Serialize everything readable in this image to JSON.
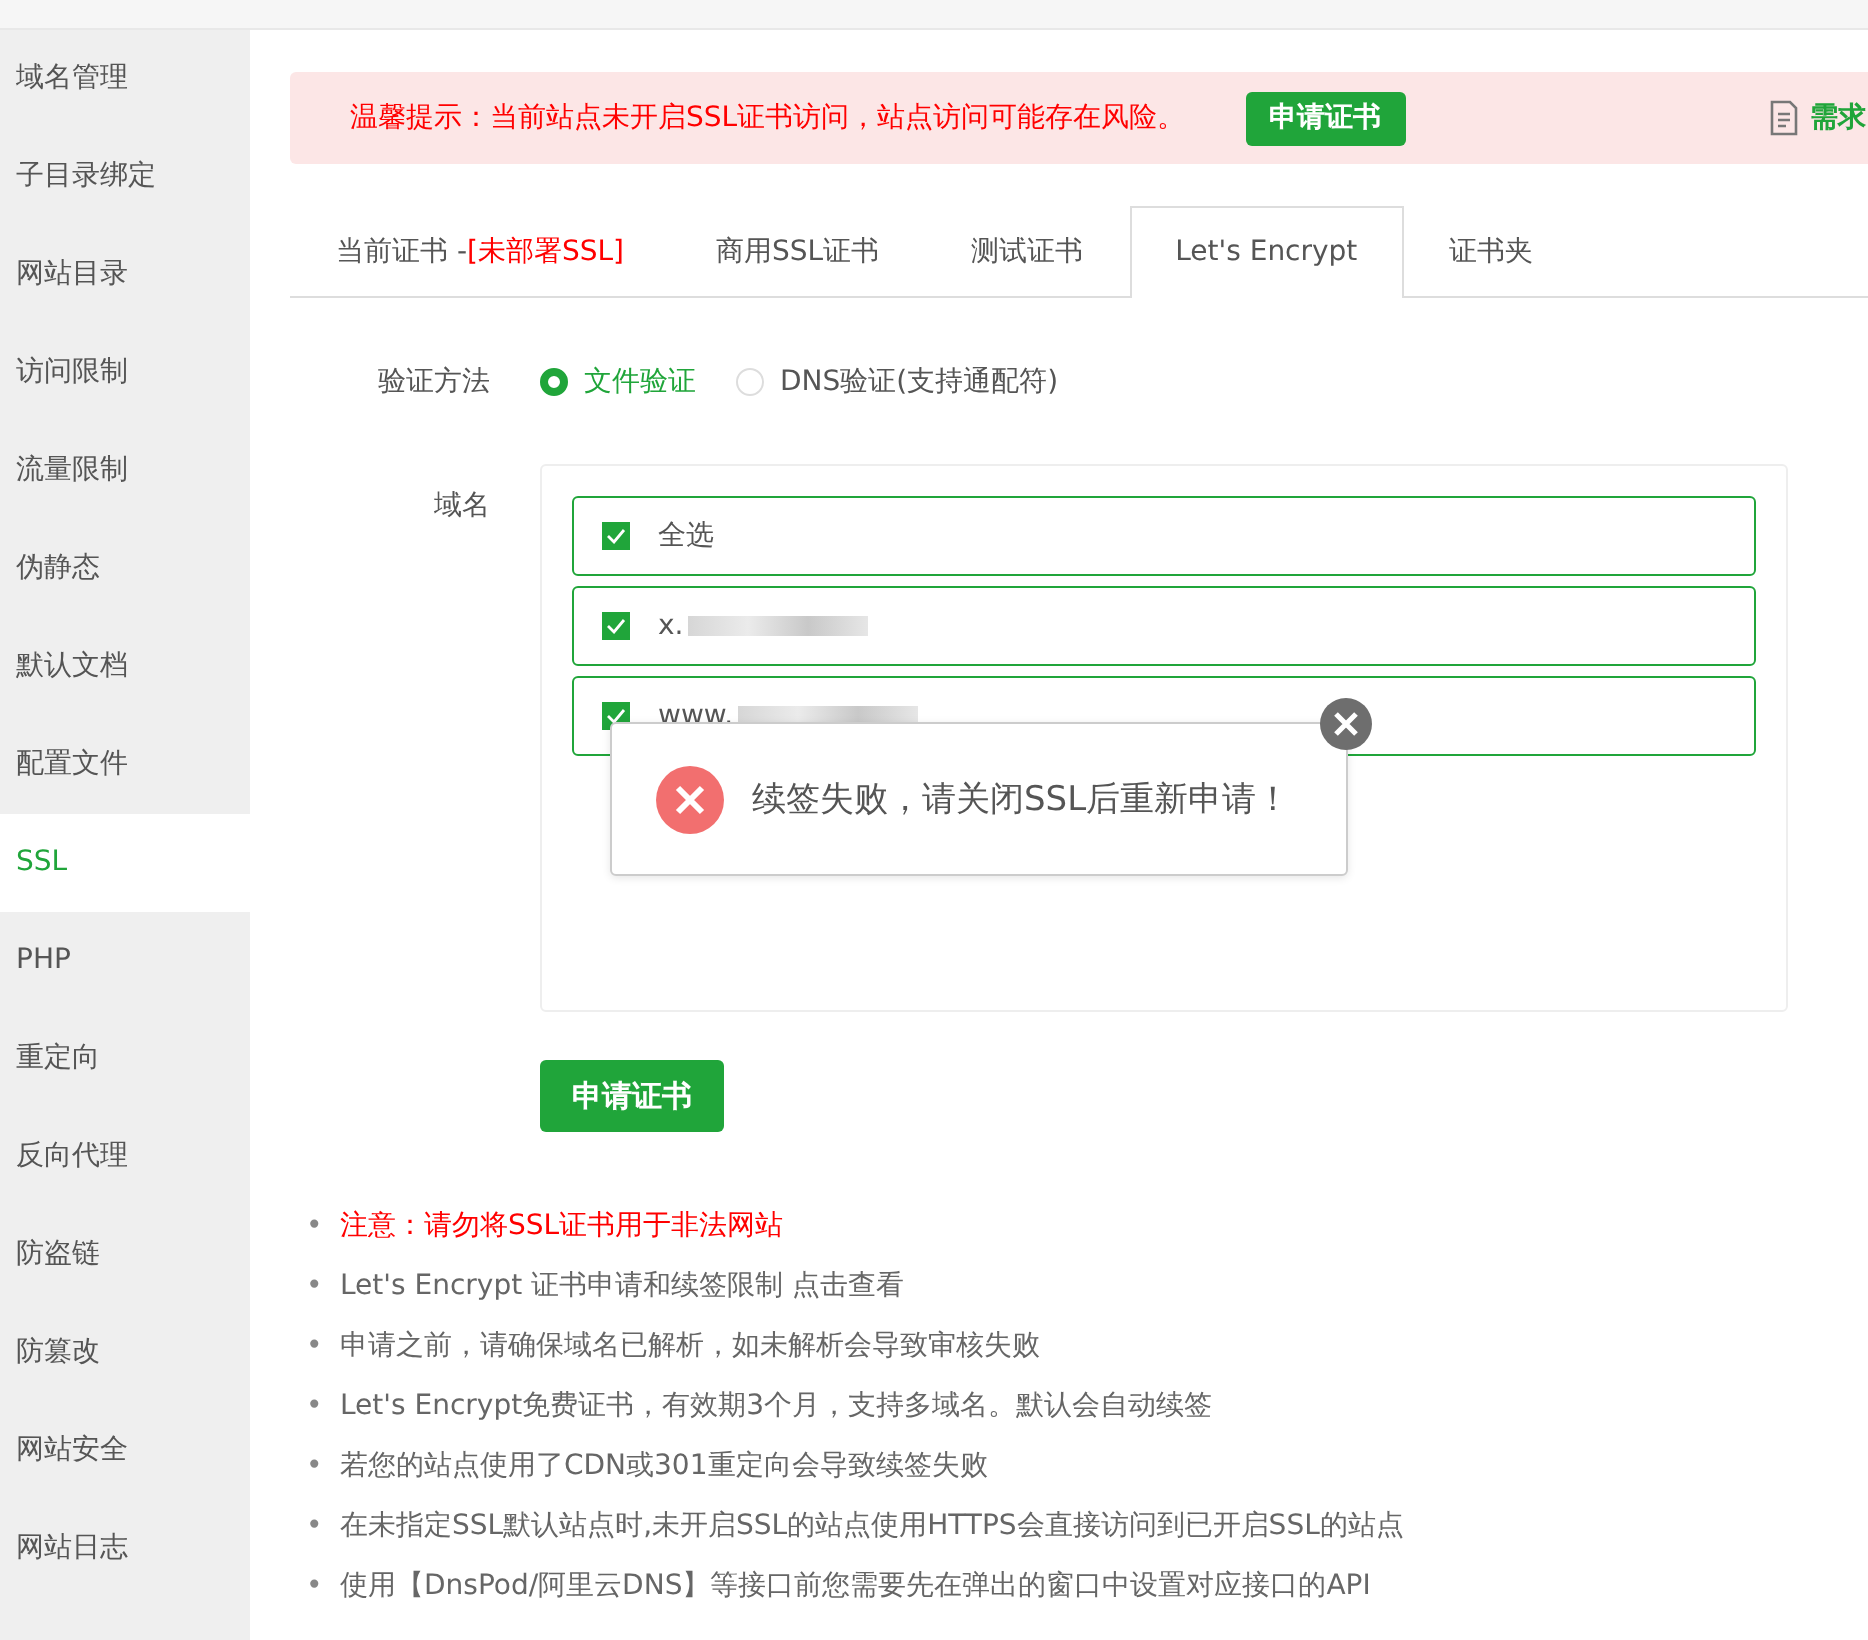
{
  "sidebar": {
    "items": [
      {
        "label": "域名管理",
        "selected": false
      },
      {
        "label": "子目录绑定",
        "selected": false
      },
      {
        "label": "网站目录",
        "selected": false
      },
      {
        "label": "访问限制",
        "selected": false
      },
      {
        "label": "流量限制",
        "selected": false
      },
      {
        "label": "伪静态",
        "selected": false
      },
      {
        "label": "默认文档",
        "selected": false
      },
      {
        "label": "配置文件",
        "selected": false
      },
      {
        "label": "SSL",
        "selected": true
      },
      {
        "label": "PHP",
        "selected": false
      },
      {
        "label": "重定向",
        "selected": false
      },
      {
        "label": "反向代理",
        "selected": false
      },
      {
        "label": "防盗链",
        "selected": false
      },
      {
        "label": "防篡改",
        "selected": false
      },
      {
        "label": "网站安全",
        "selected": false
      },
      {
        "label": "网站日志",
        "selected": false
      }
    ]
  },
  "banner": {
    "text": "温馨提示：当前站点未开启SSL证书访问，站点访问可能存在风险。",
    "button": "申请证书",
    "link": "需求"
  },
  "tabs": [
    {
      "label": "当前证书 -",
      "extra": "[未部署SSL]",
      "selected": false
    },
    {
      "label": "商用SSL证书",
      "selected": false
    },
    {
      "label": "测试证书",
      "selected": false
    },
    {
      "label": "Let's Encrypt",
      "selected": true
    },
    {
      "label": "证书夹",
      "selected": false
    }
  ],
  "form": {
    "method_label": "验证方法",
    "methods": [
      {
        "label": "文件验证",
        "selected": true
      },
      {
        "label": "DNS验证(支持通配符)",
        "selected": false
      }
    ],
    "domain_label": "域名",
    "domains": [
      {
        "label": "全选",
        "checked": true,
        "redacted": false
      },
      {
        "label": "x.",
        "checked": true,
        "redacted": true
      },
      {
        "label": "www.",
        "checked": true,
        "redacted": true
      }
    ],
    "submit": "申请证书"
  },
  "toast": {
    "message": "续签失败，请关闭SSL后重新申请！"
  },
  "notes": [
    {
      "bullet": "•",
      "text": "注意：请勿将SSL证书用于非法网站",
      "kind": "warning"
    },
    {
      "bullet": "•",
      "text": "Let's Encrypt 证书申请和续签限制 点击查看",
      "kind": "normal"
    },
    {
      "bullet": "•",
      "text": "申请之前，请确保域名已解析，如未解析会导致审核失败",
      "kind": "normal"
    },
    {
      "bullet": "•",
      "text": "Let's Encrypt免费证书，有效期3个月，支持多域名。默认会自动续签",
      "kind": "normal"
    },
    {
      "bullet": "•",
      "text": "若您的站点使用了CDN或301重定向会导致续签失败",
      "kind": "normal"
    },
    {
      "bullet": "•",
      "text": "在未指定SSL默认站点时,未开启SSL的站点使用HTTPS会直接访问到已开启SSL的站点",
      "kind": "normal"
    },
    {
      "bullet": "•",
      "text": "使用【DnsPod/阿里云DNS】等接口前您需要先在弹出的窗口中设置对应接口的API",
      "kind": "normal"
    }
  ]
}
